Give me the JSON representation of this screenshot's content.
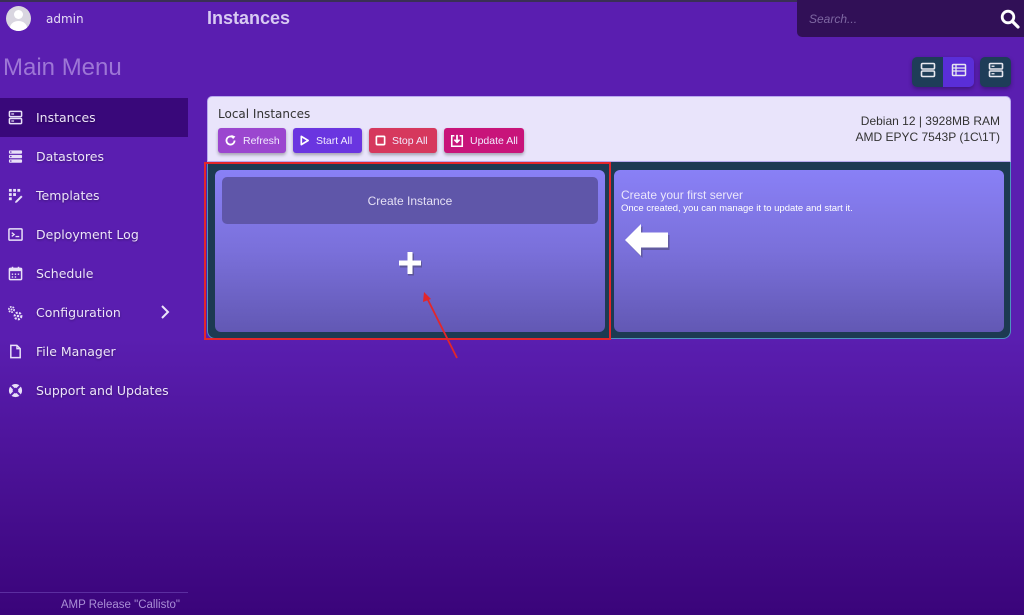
{
  "user": {
    "name": "admin"
  },
  "sidebar": {
    "title": "Main Menu",
    "items": [
      {
        "label": "Instances",
        "icon": "server-icon",
        "active": true
      },
      {
        "label": "Datastores",
        "icon": "datastore-icon"
      },
      {
        "label": "Templates",
        "icon": "templates-icon"
      },
      {
        "label": "Deployment Log",
        "icon": "terminal-icon"
      },
      {
        "label": "Schedule",
        "icon": "calendar-icon"
      },
      {
        "label": "Configuration",
        "icon": "gears-icon",
        "has_submenu": true
      },
      {
        "label": "File Manager",
        "icon": "file-icon"
      },
      {
        "label": "Support and Updates",
        "icon": "lifebuoy-icon"
      }
    ],
    "footer": "AMP Release \"Callisto\""
  },
  "header": {
    "title": "Instances",
    "search_placeholder": "Search..."
  },
  "view_modes": [
    {
      "name": "rows-view",
      "active": false
    },
    {
      "name": "list-view",
      "active": true
    },
    {
      "name": "server-view",
      "active": false
    }
  ],
  "panel": {
    "title": "Local Instances",
    "buttons": {
      "refresh": "Refresh",
      "start_all": "Start All",
      "stop_all": "Stop All",
      "update_all": "Update All"
    },
    "system_info": {
      "os_ram": "Debian  12 | 3928MB RAM",
      "cpu": "AMD EPYC 7543P (1C\\1T)"
    },
    "create_card": {
      "label": "Create Instance"
    },
    "info_card": {
      "title": "Create your first server",
      "subtitle": "Once created, you can manage it to update and start it."
    }
  },
  "colors": {
    "accent": "#5a2ed8",
    "refresh": "#9b46cf",
    "start": "#6a35e0",
    "stop": "#d6385d",
    "update": "#c8147a",
    "highlight": "#e3262a"
  }
}
